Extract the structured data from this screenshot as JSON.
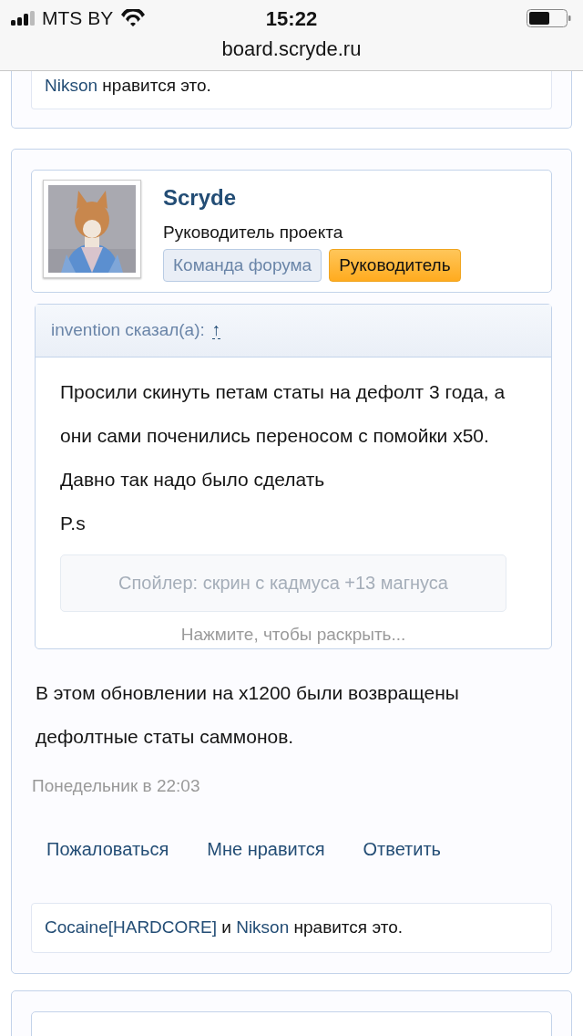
{
  "status_bar": {
    "carrier": "MTS BY",
    "time": "15:22"
  },
  "address_bar": {
    "url": "board.scryde.ru"
  },
  "previous_post": {
    "likes": [
      {
        "kind": "link",
        "text": "Nikson"
      },
      {
        "kind": "text",
        "text": " нравится это."
      }
    ]
  },
  "post": {
    "author": "Scryde",
    "user_title": "Руководитель проекта",
    "avatar": {
      "kind": "picture"
    },
    "banners": [
      {
        "kind": "team",
        "label": "Команда форума"
      },
      {
        "kind": "leader",
        "label": "Руководитель"
      }
    ],
    "quote": {
      "author": "invention сказал(а):",
      "jump": "↑",
      "lines": [
        "Просили скинуть петам статы на дефолт 3 года, а они сами поченились переносом с помойки x50. Давно так надо было сделать",
        "P.s"
      ],
      "spoiler": "Спойлер: скрин с кадмуса +13 магнуса",
      "expand_hint": "Нажмите, чтобы раскрыть..."
    },
    "message": "В этом обновлении на x1200 были возвращены дефолтные статы саммонов.",
    "date": "Понедельник в 22:03",
    "actions": [
      "Пожаловаться",
      "Мне нравится",
      "Ответить"
    ],
    "likes": [
      {
        "kind": "link",
        "text": "Cocaine[HARDCORE]"
      },
      {
        "kind": "text",
        "text": " и "
      },
      {
        "kind": "link",
        "text": "Nikson"
      },
      {
        "kind": "text",
        "text": " нравится это."
      }
    ]
  }
}
